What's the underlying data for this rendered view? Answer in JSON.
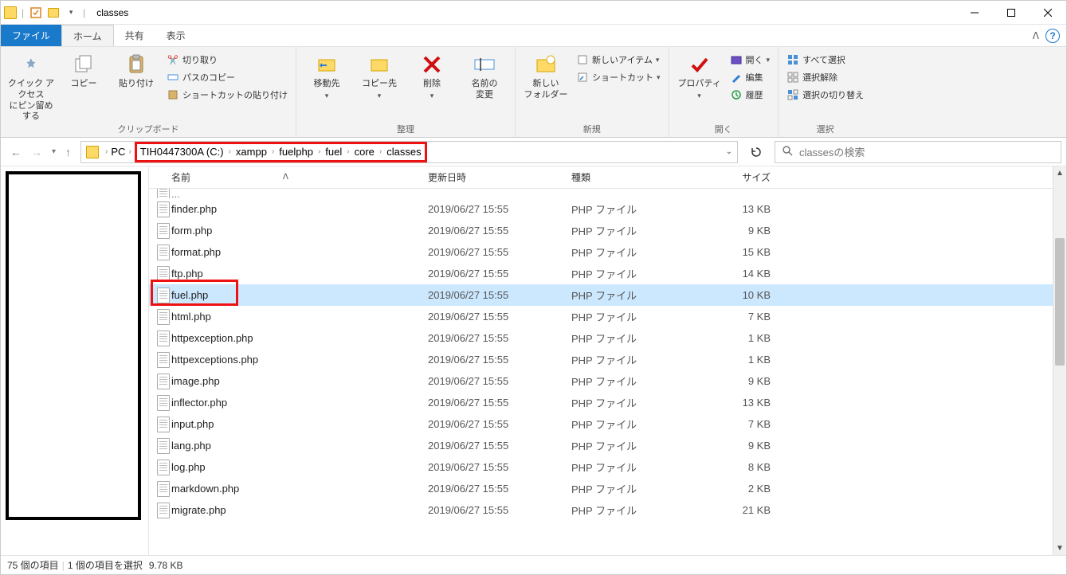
{
  "titlebar": {
    "title": "classes"
  },
  "tabs": {
    "file": "ファイル",
    "home": "ホーム",
    "share": "共有",
    "view": "表示"
  },
  "ribbon": {
    "clipboard": {
      "pin": "クイック アクセス\nにピン留めする",
      "copy": "コピー",
      "paste": "貼り付け",
      "cut": "切り取り",
      "copy_path": "パスのコピー",
      "paste_shortcut": "ショートカットの貼り付け",
      "label": "クリップボード"
    },
    "organize": {
      "move": "移動先",
      "copyto": "コピー先",
      "delete": "削除",
      "rename": "名前の\n変更",
      "label": "整理"
    },
    "new": {
      "newfolder": "新しい\nフォルダー",
      "newitem": "新しいアイテム",
      "shortcut": "ショートカット",
      "label": "新規"
    },
    "open": {
      "properties": "プロパティ",
      "open": "開く",
      "edit": "編集",
      "history": "履歴",
      "label": "開く"
    },
    "select": {
      "select_all": "すべて選択",
      "select_none": "選択解除",
      "invert": "選択の切り替え",
      "label": "選択"
    }
  },
  "address": {
    "pc": "PC",
    "drive": "TIH0447300A (C:)",
    "p1": "xampp",
    "p2": "fuelphp",
    "p3": "fuel",
    "p4": "core",
    "p5": "classes"
  },
  "search": {
    "placeholder": "classesの検索"
  },
  "columns": {
    "name": "名前",
    "date": "更新日時",
    "type": "種類",
    "size": "サイズ"
  },
  "files": [
    {
      "name": "finder.php",
      "date": "2019/06/27 15:55",
      "type": "PHP ファイル",
      "size": "13 KB"
    },
    {
      "name": "form.php",
      "date": "2019/06/27 15:55",
      "type": "PHP ファイル",
      "size": "9 KB"
    },
    {
      "name": "format.php",
      "date": "2019/06/27 15:55",
      "type": "PHP ファイル",
      "size": "15 KB"
    },
    {
      "name": "ftp.php",
      "date": "2019/06/27 15:55",
      "type": "PHP ファイル",
      "size": "14 KB"
    },
    {
      "name": "fuel.php",
      "date": "2019/06/27 15:55",
      "type": "PHP ファイル",
      "size": "10 KB",
      "selected": true,
      "highlight": true
    },
    {
      "name": "html.php",
      "date": "2019/06/27 15:55",
      "type": "PHP ファイル",
      "size": "7 KB"
    },
    {
      "name": "httpexception.php",
      "date": "2019/06/27 15:55",
      "type": "PHP ファイル",
      "size": "1 KB"
    },
    {
      "name": "httpexceptions.php",
      "date": "2019/06/27 15:55",
      "type": "PHP ファイル",
      "size": "1 KB"
    },
    {
      "name": "image.php",
      "date": "2019/06/27 15:55",
      "type": "PHP ファイル",
      "size": "9 KB"
    },
    {
      "name": "inflector.php",
      "date": "2019/06/27 15:55",
      "type": "PHP ファイル",
      "size": "13 KB"
    },
    {
      "name": "input.php",
      "date": "2019/06/27 15:55",
      "type": "PHP ファイル",
      "size": "7 KB"
    },
    {
      "name": "lang.php",
      "date": "2019/06/27 15:55",
      "type": "PHP ファイル",
      "size": "9 KB"
    },
    {
      "name": "log.php",
      "date": "2019/06/27 15:55",
      "type": "PHP ファイル",
      "size": "8 KB"
    },
    {
      "name": "markdown.php",
      "date": "2019/06/27 15:55",
      "type": "PHP ファイル",
      "size": "2 KB"
    },
    {
      "name": "migrate.php",
      "date": "2019/06/27 15:55",
      "type": "PHP ファイル",
      "size": "21 KB"
    }
  ],
  "status": {
    "count": "75 個の項目",
    "selection": "1 個の項目を選択",
    "size": "9.78 KB"
  }
}
